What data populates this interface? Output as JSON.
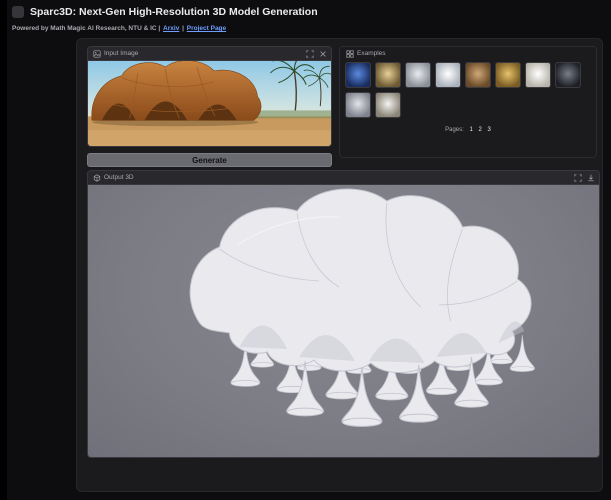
{
  "header": {
    "title": "Sparc3D: Next-Gen High-Resolution 3D Model Generation",
    "subtitle_prefix": "Powered by Math Magic AI Research, NTU & IC |",
    "link_arxiv": "Arxiv",
    "link_separator": "|",
    "link_project": "Project Page"
  },
  "input_panel": {
    "label": "Input Image"
  },
  "generate": {
    "label": "Generate"
  },
  "examples": {
    "label": "Examples",
    "pages_label": "Pages:",
    "pages": [
      "1",
      "2",
      "3"
    ],
    "thumbnails": [
      {
        "name": "blue-crystal-dragon",
        "c1": "#5a8ae0",
        "c2": "#1a2c5e"
      },
      {
        "name": "gold-ring",
        "c1": "#e8cf96",
        "c2": "#6b5a33"
      },
      {
        "name": "silver-dragon",
        "c1": "#e8eaee",
        "c2": "#8a8f98"
      },
      {
        "name": "white-eagle",
        "c1": "#ffffff",
        "c2": "#aab2bc"
      },
      {
        "name": "bronze-owl",
        "c1": "#d0a878",
        "c2": "#6a4a28"
      },
      {
        "name": "gold-statue-group",
        "c1": "#e6c26a",
        "c2": "#7a5c24"
      },
      {
        "name": "deer-skull",
        "c1": "#ffffff",
        "c2": "#b8b4aa"
      },
      {
        "name": "dark-robot",
        "c1": "#787e8a",
        "c2": "#1e2026"
      },
      {
        "name": "silver-lion-head",
        "c1": "#e2e4e8",
        "c2": "#7e828c"
      },
      {
        "name": "spider",
        "c1": "#f4f3f0",
        "c2": "#8a8478"
      }
    ]
  },
  "output_panel": {
    "label": "Output 3D"
  },
  "theme": {
    "page-bg": "#0d0d0f",
    "edge-strip": "#000000",
    "app-bg": "#1b1b1e",
    "panel-bg": "#202023",
    "panel-header": "#29292d",
    "panel-border": "#38383d",
    "text-main": "#ececef",
    "text-muted": "#a9a9af",
    "link": "#6f9eff",
    "button-bg": "#6a6a71",
    "button-text": "#101013",
    "viewport-bg": "#7d7d86",
    "model-fill": "#e9e9ee",
    "model-shade": "#c4c4cf",
    "sky-top": "#8fc8e6",
    "sand": "#c89a60",
    "palm": "#2e4f2a"
  }
}
